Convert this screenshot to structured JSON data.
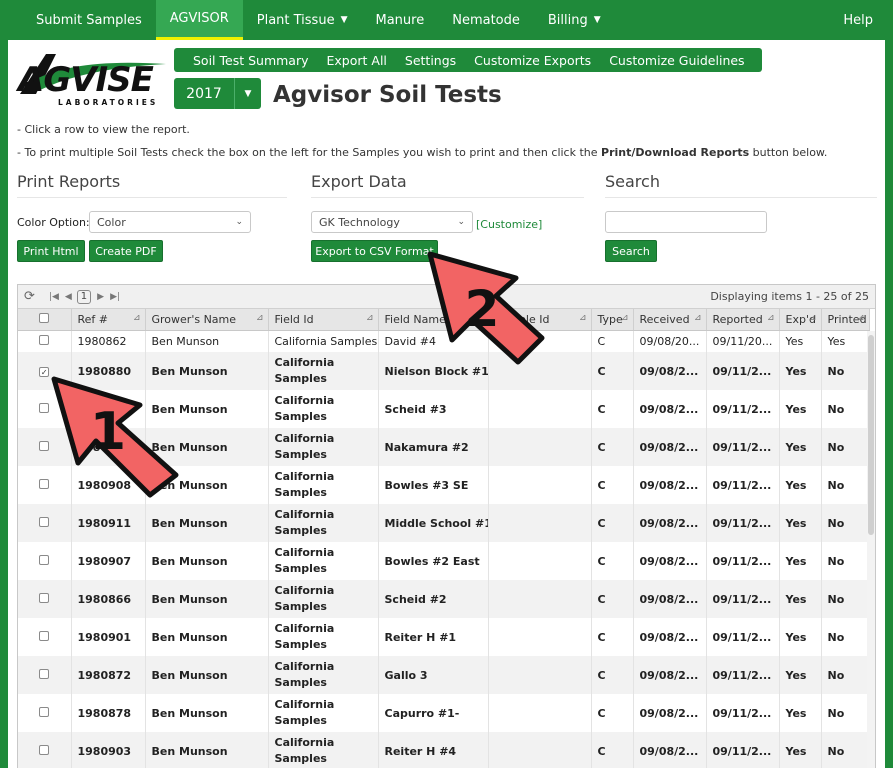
{
  "topnav": {
    "items": [
      {
        "label": "Submit Samples",
        "active": false,
        "dropdown": false
      },
      {
        "label": "AGVISOR",
        "active": true,
        "dropdown": false
      },
      {
        "label": "Plant Tissue",
        "active": false,
        "dropdown": true
      },
      {
        "label": "Manure",
        "active": false,
        "dropdown": false
      },
      {
        "label": "Nematode",
        "active": false,
        "dropdown": false
      },
      {
        "label": "Billing",
        "active": false,
        "dropdown": true
      }
    ],
    "help": "Help"
  },
  "logo": {
    "brand": "AGVISE",
    "sub": "LABORATORIES"
  },
  "subnav": [
    "Soil Test Summary",
    "Export All",
    "Settings",
    "Customize Exports",
    "Customize Guidelines"
  ],
  "year": "2017",
  "title": "Agvisor Soil Tests",
  "instructions": {
    "line1": "- Click a row to view the report.",
    "line2_pre": "- To print multiple Soil Tests check the box on the left for the Samples you wish to print and then click the ",
    "line2_bold": "Print/Download Reports",
    "line2_post": " button below."
  },
  "print": {
    "title": "Print Reports",
    "color_label": "Color Option:",
    "color_value": "Color",
    "btn_html": "Print Html",
    "btn_pdf": "Create PDF"
  },
  "export": {
    "title": "Export Data",
    "format_value": "GK Technology",
    "customize": "[Customize]",
    "btn_csv": "Export to CSV Format"
  },
  "search": {
    "title": "Search",
    "value": "",
    "btn": "Search"
  },
  "grid": {
    "page": "1",
    "display": "Displaying items 1 - 25 of 25",
    "columns": [
      "Ref #",
      "Grower's Name",
      "Field Id",
      "Field Name",
      "Sample Id",
      "Type",
      "Received",
      "Reported",
      "Exp'd",
      "Printed"
    ],
    "rows": [
      {
        "checked": false,
        "bold": false,
        "ref": "1980862",
        "grower": "Ben Munson",
        "field_id": "California Samples",
        "field_name": "David #4",
        "sample_id": "",
        "type": "C",
        "received": "09/08/20...",
        "reported": "09/11/20...",
        "exp": "Yes",
        "printed": "Yes"
      },
      {
        "checked": true,
        "bold": true,
        "ref": "1980880",
        "grower": "Ben Munson",
        "field_id": "California Samples",
        "field_name": "Nielson Block #1",
        "sample_id": "",
        "type": "C",
        "received": "09/08/2...",
        "reported": "09/11/2...",
        "exp": "Yes",
        "printed": "No"
      },
      {
        "checked": false,
        "bold": true,
        "ref": "1980906",
        "grower": "Ben Munson",
        "field_id": "California Samples",
        "field_name": "Scheid #3",
        "sample_id": "",
        "type": "C",
        "received": "09/08/2...",
        "reported": "09/11/2...",
        "exp": "Yes",
        "printed": "No"
      },
      {
        "checked": false,
        "bold": true,
        "ref": "1980909",
        "grower": "Ben Munson",
        "field_id": "California Samples",
        "field_name": "Nakamura #2",
        "sample_id": "",
        "type": "C",
        "received": "09/08/2...",
        "reported": "09/11/2...",
        "exp": "Yes",
        "printed": "No"
      },
      {
        "checked": false,
        "bold": true,
        "ref": "1980908",
        "grower": "Ben Munson",
        "field_id": "California Samples",
        "field_name": "Bowles #3 SE",
        "sample_id": "",
        "type": "C",
        "received": "09/08/2...",
        "reported": "09/11/2...",
        "exp": "Yes",
        "printed": "No"
      },
      {
        "checked": false,
        "bold": true,
        "ref": "1980911",
        "grower": "Ben Munson",
        "field_id": "California Samples",
        "field_name": "Middle School #1",
        "sample_id": "",
        "type": "C",
        "received": "09/08/2...",
        "reported": "09/11/2...",
        "exp": "Yes",
        "printed": "No"
      },
      {
        "checked": false,
        "bold": true,
        "ref": "1980907",
        "grower": "Ben Munson",
        "field_id": "California Samples",
        "field_name": "Bowles #2 East",
        "sample_id": "",
        "type": "C",
        "received": "09/08/2...",
        "reported": "09/11/2...",
        "exp": "Yes",
        "printed": "No"
      },
      {
        "checked": false,
        "bold": true,
        "ref": "1980866",
        "grower": "Ben Munson",
        "field_id": "California Samples",
        "field_name": "Scheid #2",
        "sample_id": "",
        "type": "C",
        "received": "09/08/2...",
        "reported": "09/11/2...",
        "exp": "Yes",
        "printed": "No"
      },
      {
        "checked": false,
        "bold": true,
        "ref": "1980901",
        "grower": "Ben Munson",
        "field_id": "California Samples",
        "field_name": "Reiter H #1",
        "sample_id": "",
        "type": "C",
        "received": "09/08/2...",
        "reported": "09/11/2...",
        "exp": "Yes",
        "printed": "No"
      },
      {
        "checked": false,
        "bold": true,
        "ref": "1980872",
        "grower": "Ben Munson",
        "field_id": "California Samples",
        "field_name": "Gallo 3",
        "sample_id": "",
        "type": "C",
        "received": "09/08/2...",
        "reported": "09/11/2...",
        "exp": "Yes",
        "printed": "No"
      },
      {
        "checked": false,
        "bold": true,
        "ref": "1980878",
        "grower": "Ben Munson",
        "field_id": "California Samples",
        "field_name": "Capurro #1-",
        "sample_id": "",
        "type": "C",
        "received": "09/08/2...",
        "reported": "09/11/2...",
        "exp": "Yes",
        "printed": "No"
      },
      {
        "checked": false,
        "bold": true,
        "ref": "1980903",
        "grower": "Ben Munson",
        "field_id": "California Samples",
        "field_name": "Reiter H #4",
        "sample_id": "",
        "type": "C",
        "received": "09/08/2...",
        "reported": "09/11/2...",
        "exp": "Yes",
        "printed": "No"
      }
    ]
  },
  "annotations": {
    "arrow1": "1",
    "arrow2": "2",
    "color": "#f26464"
  }
}
